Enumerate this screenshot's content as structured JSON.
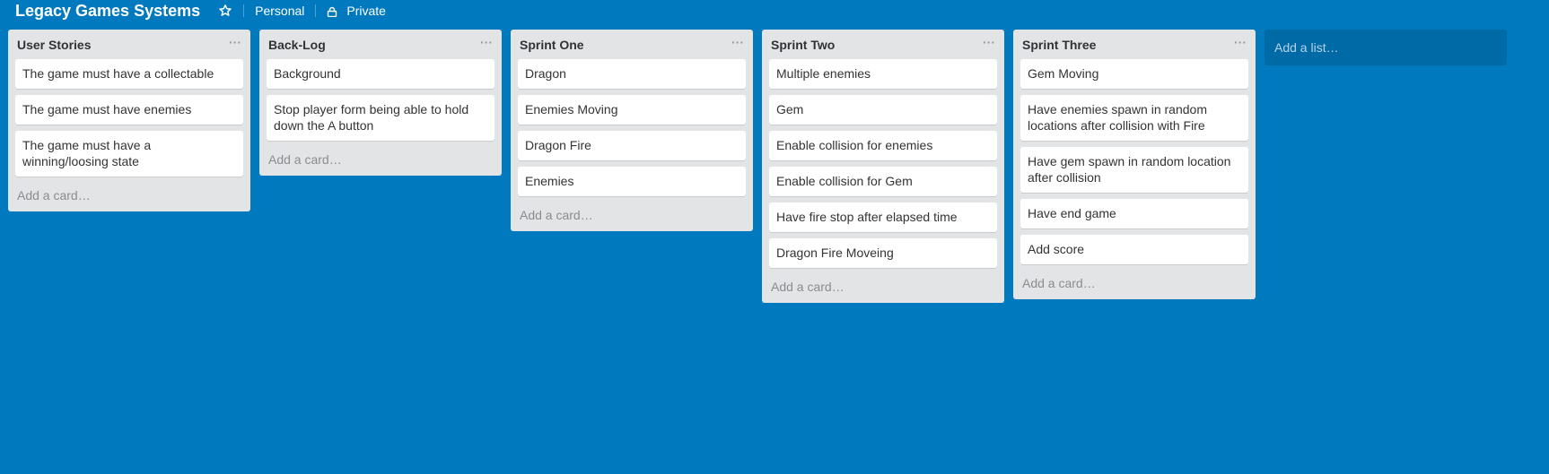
{
  "board": {
    "title": "Legacy Games Systems",
    "visibility_team": "Personal",
    "visibility_privacy": "Private"
  },
  "lists": [
    {
      "title": "User Stories",
      "menu": "···",
      "cards": [
        "The game must have a collectable",
        "The game must have enemies",
        "The game must have a winning/loosing state"
      ],
      "add_card": "Add a card…"
    },
    {
      "title": "Back-Log",
      "menu": "···",
      "cards": [
        "Background",
        "Stop player form being able to hold down the A button"
      ],
      "add_card": "Add a card…"
    },
    {
      "title": "Sprint One",
      "menu": "···",
      "cards": [
        "Dragon",
        "Enemies Moving",
        "Dragon Fire",
        "Enemies"
      ],
      "add_card": "Add a card…"
    },
    {
      "title": "Sprint Two",
      "menu": "···",
      "cards": [
        "Multiple enemies",
        "Gem",
        "Enable collision for enemies",
        "Enable collision for Gem",
        "Have fire stop after elapsed time",
        "Dragon Fire Moveing"
      ],
      "add_card": "Add a card…"
    },
    {
      "title": "Sprint Three",
      "menu": "···",
      "cards": [
        "Gem Moving",
        "Have enemies spawn in random locations after collision with Fire",
        "Have gem spawn in random location after collision",
        "Have end game",
        "Add score"
      ],
      "add_card": "Add a card…"
    }
  ],
  "add_list": "Add a list…",
  "colors": {
    "board_background": "#0079bf",
    "list_background": "#e2e4e6",
    "add_list_background": "#006aa7"
  }
}
